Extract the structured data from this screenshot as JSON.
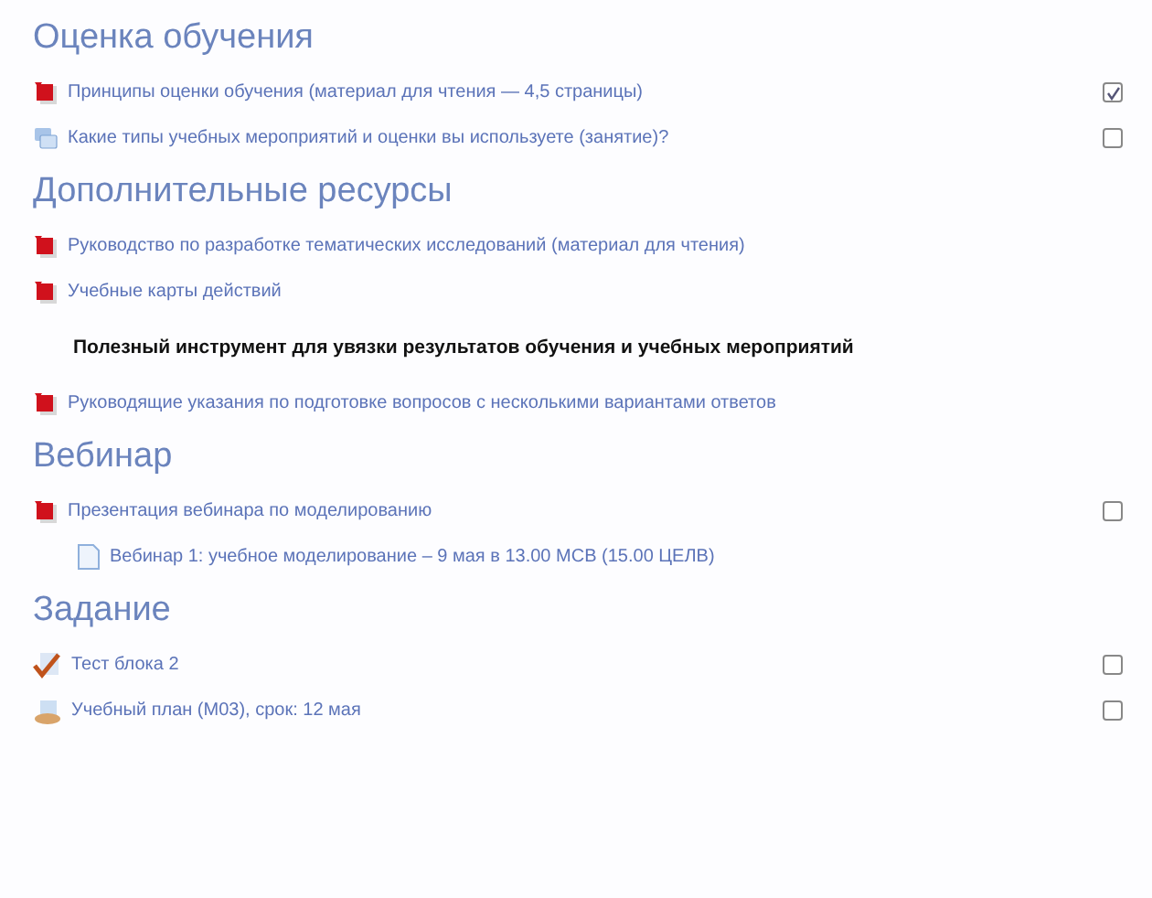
{
  "sections": [
    {
      "title": "Оценка обучения",
      "items": [
        {
          "kind": "pdf",
          "text": "Принципы оценки обучения  (материал для чтения — 4,5 страницы)",
          "checked": true
        },
        {
          "kind": "forum",
          "text": "Какие типы учебных мероприятий и оценки вы используете (занятие)?",
          "checked": false
        }
      ]
    },
    {
      "title": "Дополнительные ресурсы",
      "items": [
        {
          "kind": "pdf",
          "text": "Руководство по разработке тематических исследований (материал для чтения)"
        },
        {
          "kind": "pdf",
          "text": "Учебные карты действий"
        },
        {
          "kind": "note",
          "text": "Полезный инструмент для увязки результатов обучения и учебных мероприятий"
        },
        {
          "kind": "pdf",
          "text": "Руководящие указания по подготовке вопросов с несколькими вариантами ответов"
        }
      ]
    },
    {
      "title": "Вебинар",
      "items": [
        {
          "kind": "pdf",
          "text": "Презентация вебинара по моделированию",
          "checked": false
        },
        {
          "kind": "page",
          "text": "Вебинар 1: учебное моделирование – 9 мая в 13.00 МСВ (15.00 ЦЕЛВ)"
        }
      ]
    },
    {
      "title": "Задание",
      "items": [
        {
          "kind": "quiz",
          "text": "Тест блока 2",
          "checked": false
        },
        {
          "kind": "assign",
          "text": "Учебный план (М03), срок: 12 мая",
          "checked": false
        }
      ]
    }
  ]
}
